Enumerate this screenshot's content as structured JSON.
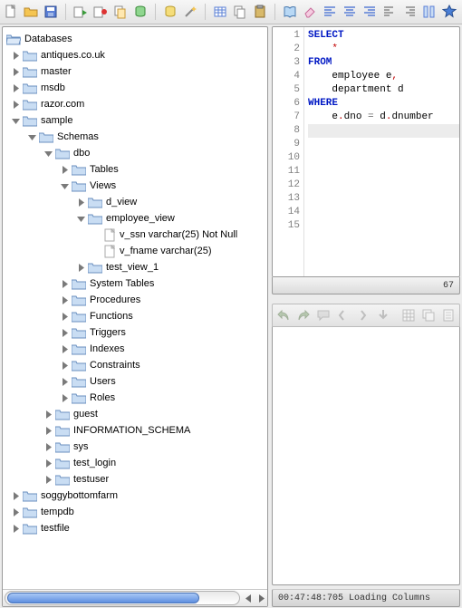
{
  "toolbar_icons": [
    "new-doc-icon",
    "open-folder-icon",
    "save-icon",
    "import-icon",
    "run-red-icon",
    "copy-icon",
    "cylinder-green-icon",
    "cylinder-yellow-icon",
    "wand-icon",
    "table-icon",
    "copy-doc-icon",
    "paste-doc-icon",
    "book-icon",
    "eraser-icon",
    "align-left-icon",
    "align-center-icon",
    "align-right-icon",
    "align-left2-icon",
    "align-right2-icon",
    "columns-icon",
    "star-icon"
  ],
  "mid_toolbar_icons": [
    "undo-icon",
    "redo-icon",
    "comment-icon",
    "step-back-icon",
    "step-fwd-icon",
    "step-into-icon",
    "grid-icon",
    "copy-grid-icon",
    "sheet-icon"
  ],
  "tree": {
    "root_label": "Databases",
    "antiques": "antiques.co.uk",
    "master": "master",
    "msdb": "msdb",
    "razor": "razor.com",
    "sample": "sample",
    "schemas": "Schemas",
    "dbo": "dbo",
    "tables": "Tables",
    "views": "Views",
    "d_view": "d_view",
    "employee_view": "employee_view",
    "v_ssn": "v_ssn varchar(25) Not Null",
    "v_fname": "v_fname varchar(25)",
    "test_view_1": "test_view_1",
    "system_tables": "System Tables",
    "procedures": "Procedures",
    "functions": "Functions",
    "triggers": "Triggers",
    "indexes": "Indexes",
    "constraints": "Constraints",
    "users": "Users",
    "roles": "Roles",
    "guest": "guest",
    "information_schema": "INFORMATION_SCHEMA",
    "sys": "sys",
    "test_login": "test_login",
    "testuser": "testuser",
    "soggybottomfarm": "soggybottomfarm",
    "tempdb": "tempdb",
    "testfile": "testfile"
  },
  "sql": {
    "select": "SELECT",
    "star": "    *",
    "from": "FROM",
    "l4a": "    employee e",
    "l4b": ",",
    "l5": "    department d",
    "where": "WHERE",
    "l7a": "    e",
    "l7b": ".",
    "l7c": "dno ",
    "l7d": "=",
    "l7e": " d",
    "l7f": ".",
    "l7g": "dnumber"
  },
  "gutter": [
    "1",
    "2",
    "3",
    "4",
    "5",
    "6",
    "7",
    "8",
    "9",
    "10",
    "11",
    "12",
    "13",
    "14",
    "15"
  ],
  "posbar": "67",
  "status": "00:47:48:705 Loading Columns"
}
